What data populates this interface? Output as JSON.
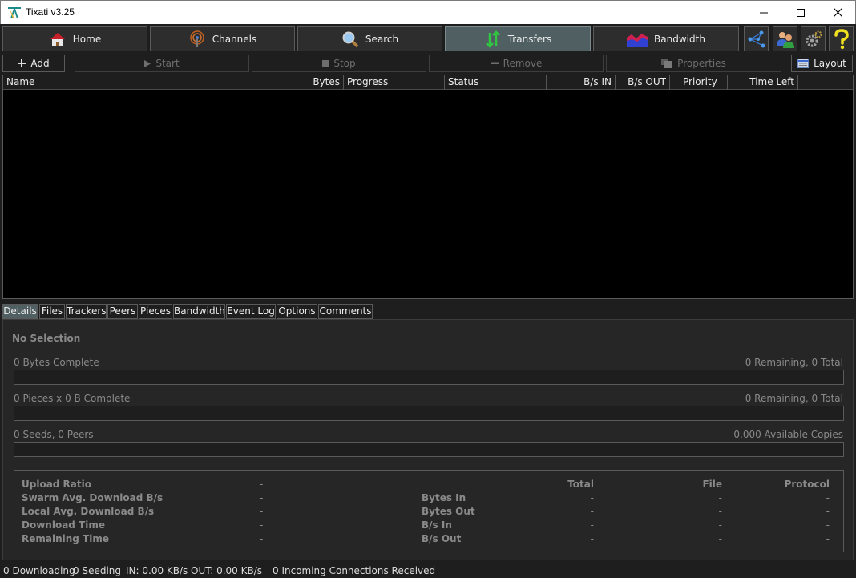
{
  "window": {
    "title": "Tixati v3.25"
  },
  "nav": {
    "home": "Home",
    "channels": "Channels",
    "search": "Search",
    "transfers": "Transfers",
    "bandwidth": "Bandwidth",
    "active": "transfers"
  },
  "actions": {
    "add": "Add",
    "start": "Start",
    "stop": "Stop",
    "remove": "Remove",
    "properties": "Properties",
    "layout": "Layout"
  },
  "table": {
    "columns": [
      "Name",
      "Bytes",
      "Progress",
      "Status",
      "B/s IN",
      "B/s OUT",
      "Priority",
      "Time Left"
    ],
    "rows": []
  },
  "tabs": [
    "Details",
    "Files",
    "Trackers",
    "Peers",
    "Pieces",
    "Bandwidth",
    "Event Log",
    "Options",
    "Comments"
  ],
  "details": {
    "selection": "No Selection",
    "bytes_complete": "0 Bytes Complete",
    "bytes_remaining": "0 Remaining,  0 Total",
    "pieces_complete": "0 Pieces  x  0 B Complete",
    "pieces_remaining": "0 Remaining,  0 Total",
    "seeds_peers": "0 Seeds, 0 Peers",
    "available_copies": "0.000 Available Copies",
    "stats_left": [
      {
        "label": "Upload Ratio",
        "value": "-"
      },
      {
        "label": "Swarm Avg. Download B/s",
        "value": "-"
      },
      {
        "label": "Local Avg. Download B/s",
        "value": "-"
      },
      {
        "label": "Download Time",
        "value": "-"
      },
      {
        "label": "Remaining Time",
        "value": "-"
      }
    ],
    "stats_headers": {
      "total": "Total",
      "file": "File",
      "protocol": "Protocol"
    },
    "stats_right": [
      {
        "label": "Bytes In",
        "total": "-",
        "file": "-",
        "protocol": "-"
      },
      {
        "label": "Bytes Out",
        "total": "-",
        "file": "-",
        "protocol": "-"
      },
      {
        "label": "B/s In",
        "total": "-",
        "file": "-",
        "protocol": "-"
      },
      {
        "label": "B/s Out",
        "total": "-",
        "file": "-",
        "protocol": "-"
      }
    ]
  },
  "status": {
    "downloading": "0 Downloading",
    "seeding": "0 Seeding",
    "in": "IN: 0.00 KB/s",
    "out": "OUT: 0.00 KB/s",
    "incoming": "0 Incoming Connections Received"
  },
  "colors": {
    "accent_active": "#4f5f62",
    "table_bg": "#000000",
    "background": "#1e1e1e"
  }
}
